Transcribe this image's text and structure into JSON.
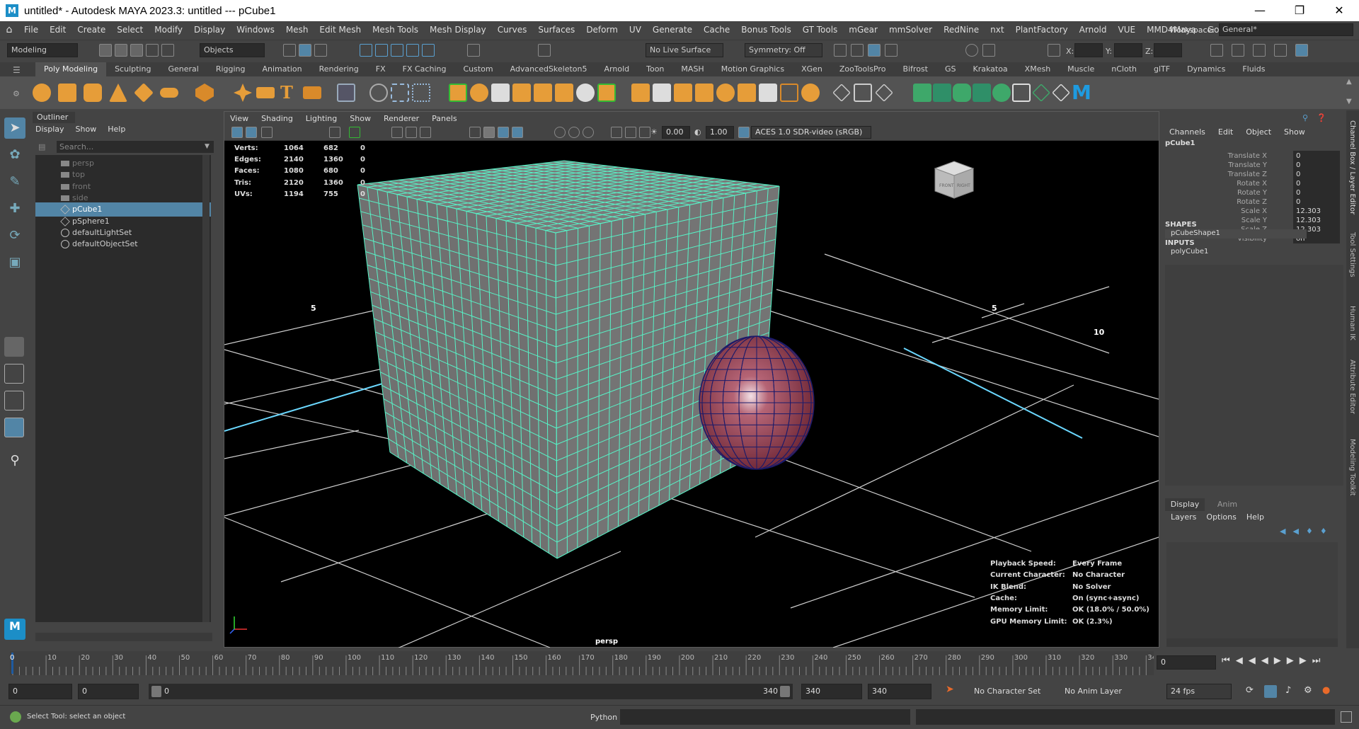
{
  "titlebar": {
    "title": "untitled* - Autodesk MAYA 2023.3: untitled   ---   pCube1",
    "app_badge": "M"
  },
  "menubar": {
    "items": [
      "File",
      "Edit",
      "Create",
      "Select",
      "Modify",
      "Display",
      "Windows",
      "Mesh",
      "Edit Mesh",
      "Mesh Tools",
      "Mesh Display",
      "Curves",
      "Surfaces",
      "Deform",
      "UV",
      "Generate",
      "Cache",
      "Bonus Tools",
      "GT Tools",
      "mGear",
      "mmSolver",
      "RedNine",
      "nxt",
      "PlantFactory",
      "Arnold",
      "VUE",
      "MMD4Maya",
      "Golaem"
    ],
    "workspace_label": "Workspace:",
    "workspace_value": "General*"
  },
  "statusline": {
    "menuset": "Modeling",
    "selection_mode": "Objects",
    "live_surface": "No Live Surface",
    "symmetry": "Symmetry: Off",
    "coord_x": "X:",
    "coord_y": "Y:",
    "coord_z": "Z:"
  },
  "shelf": {
    "tabs": [
      "Poly Modeling",
      "Sculpting",
      "General",
      "Rigging",
      "Animation",
      "Rendering",
      "FX",
      "FX Caching",
      "Custom",
      "AdvancedSkeleton5",
      "Arnold",
      "Toon",
      "MASH",
      "Motion Graphics",
      "XGen",
      "ZooToolsPro",
      "Bifrost",
      "GS",
      "Krakatoa",
      "XMesh",
      "Muscle",
      "nCloth",
      "glTF",
      "Dynamics",
      "Fluids"
    ],
    "active": "Poly Modeling"
  },
  "outliner": {
    "title": "Outliner",
    "menu": [
      "Display",
      "Show",
      "Help"
    ],
    "search_placeholder": "Search...",
    "items": [
      {
        "label": "persp",
        "kind": "camera",
        "dim": true
      },
      {
        "label": "top",
        "kind": "camera",
        "dim": true
      },
      {
        "label": "front",
        "kind": "camera",
        "dim": true
      },
      {
        "label": "side",
        "kind": "camera",
        "dim": true
      },
      {
        "label": "pCube1",
        "kind": "mesh",
        "selected": true
      },
      {
        "label": "pSphere1",
        "kind": "mesh"
      },
      {
        "label": "defaultLightSet",
        "kind": "set"
      },
      {
        "label": "defaultObjectSet",
        "kind": "set"
      }
    ]
  },
  "viewport": {
    "menu": [
      "View",
      "Shading",
      "Lighting",
      "Show",
      "Renderer",
      "Panels"
    ],
    "exposure": "0.00",
    "gamma": "1.00",
    "colorspace": "ACES 1.0 SDR-video (sRGB)",
    "camera_label": "persp",
    "grid_labels": [
      "5",
      "5",
      "10"
    ],
    "stats": [
      {
        "label": "Verts:",
        "a": "1064",
        "b": "682",
        "c": "0"
      },
      {
        "label": "Edges:",
        "a": "2140",
        "b": "1360",
        "c": "0"
      },
      {
        "label": "Faces:",
        "a": "1080",
        "b": "680",
        "c": "0"
      },
      {
        "label": "Tris:",
        "a": "2120",
        "b": "1360",
        "c": "0"
      },
      {
        "label": "UVs:",
        "a": "1194",
        "b": "755",
        "c": "0"
      }
    ],
    "info": [
      {
        "label": "Playback Speed:",
        "value": "Every Frame"
      },
      {
        "label": "Current Character:",
        "value": "No Character"
      },
      {
        "label": "IK Blend:",
        "value": "No Solver"
      },
      {
        "label": "Cache:",
        "value": "On (sync+async)"
      },
      {
        "label": "Memory Limit:",
        "value": "OK (18.0% / 50.0%)"
      },
      {
        "label": "GPU Memory Limit:",
        "value": "OK (2.3%)"
      }
    ],
    "viewcube": {
      "front": "FRONT",
      "right": "RIGHT"
    }
  },
  "channelbox": {
    "menu": [
      "Channels",
      "Edit",
      "Object",
      "Show"
    ],
    "object": "pCube1",
    "attrs": [
      {
        "label": "Translate X",
        "value": "0"
      },
      {
        "label": "Translate Y",
        "value": "0"
      },
      {
        "label": "Translate Z",
        "value": "0"
      },
      {
        "label": "Rotate X",
        "value": "0"
      },
      {
        "label": "Rotate Y",
        "value": "0"
      },
      {
        "label": "Rotate Z",
        "value": "0"
      },
      {
        "label": "Scale X",
        "value": "12.303"
      },
      {
        "label": "Scale Y",
        "value": "12.303"
      },
      {
        "label": "Scale Z",
        "value": "12.303"
      },
      {
        "label": "Visibility",
        "value": "on"
      }
    ],
    "shapes_header": "SHAPES",
    "shape": "pCubeShape1",
    "inputs_header": "INPUTS",
    "input": "polyCube1"
  },
  "side_tabs": [
    "Channel Box / Layer Editor",
    "Tool Settings",
    "Human IK",
    "Attribute Editor",
    "Modeling Toolkit"
  ],
  "layers": {
    "tabs": [
      "Display",
      "Anim"
    ],
    "menu": [
      "Layers",
      "Options",
      "Help"
    ]
  },
  "timeline": {
    "ticks": [
      "10",
      "20",
      "30",
      "40",
      "50",
      "60",
      "70",
      "80",
      "90",
      "100",
      "110",
      "120",
      "130",
      "140",
      "150",
      "160",
      "170",
      "180",
      "190",
      "200",
      "210",
      "220",
      "230",
      "240",
      "250",
      "260",
      "270",
      "280",
      "290",
      "300",
      "310",
      "320",
      "330",
      "34"
    ],
    "current_frame": "0",
    "frame_marker": "0"
  },
  "range": {
    "start": "0",
    "playback_start": "0",
    "slider_start": "0",
    "slider_end": "340",
    "playback_end": "340",
    "end": "340",
    "character_set": "No Character Set",
    "anim_layer": "No Anim Layer",
    "fps": "24 fps"
  },
  "cmd": {
    "help": "Select Tool: select an object",
    "lang": "Python"
  }
}
